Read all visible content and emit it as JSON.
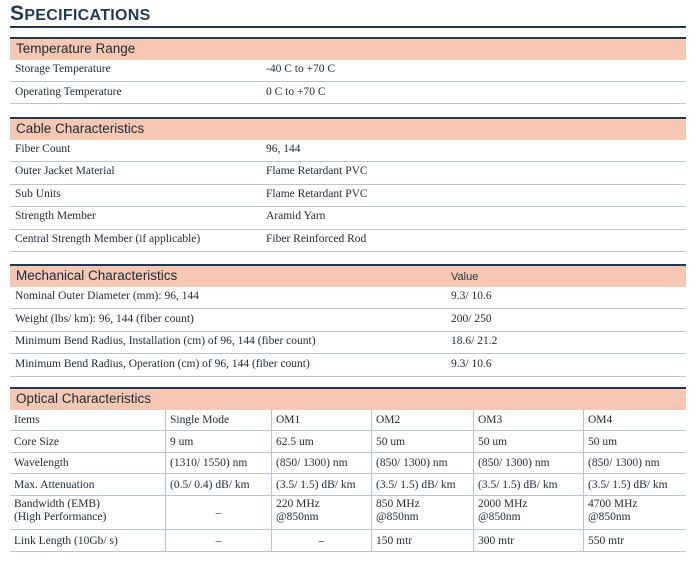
{
  "title": {
    "cap": "S",
    "rest": "PECIFICATIONS"
  },
  "temperature": {
    "header": "Temperature Range",
    "rows": [
      {
        "label": "Storage Temperature",
        "value": "-40 C to +70 C"
      },
      {
        "label": "Operating Temperature",
        "value": "0 C to +70 C"
      }
    ]
  },
  "cable": {
    "header": "Cable Characteristics",
    "rows": [
      {
        "label": "Fiber Count",
        "value": "96, 144"
      },
      {
        "label": "Outer Jacket Material",
        "value": "Flame Retardant PVC"
      },
      {
        "label": "Sub Units",
        "value": "Flame Retardant PVC"
      },
      {
        "label": "Strength Member",
        "value": "Aramid Yarn"
      },
      {
        "label": "Central Strength Member (if applicable)",
        "value": "Fiber Reinforced Rod"
      }
    ]
  },
  "mechanical": {
    "header": "Mechanical Characteristics",
    "value_header": "Value",
    "rows": [
      {
        "label": "Nominal Outer Diameter (mm): 96, 144",
        "value": "9.3/ 10.6"
      },
      {
        "label": "Weight (lbs/ km): 96, 144 (fiber count)",
        "value": "200/ 250"
      },
      {
        "label": "Minimum Bend Radius, Installation (cm) of 96, 144 (fiber count)",
        "value": "18.6/ 21.2"
      },
      {
        "label": "Minimum Bend Radius, Operation (cm) of 96, 144 (fiber count)",
        "value": "9.3/ 10.6"
      }
    ]
  },
  "optical": {
    "header": "Optical Characteristics",
    "columns": [
      "Items",
      "Single Mode",
      "OM1",
      "OM2",
      "OM3",
      "OM4"
    ],
    "rows": [
      [
        "Core Size",
        "9 um",
        "62.5 um",
        "50 um",
        "50 um",
        "50 um"
      ],
      [
        "Wavelength",
        "(1310/ 1550) nm",
        "(850/ 1300) nm",
        "(850/ 1300) nm",
        "(850/ 1300) nm",
        "(850/ 1300) nm"
      ],
      [
        "Max. Attenuation",
        "(0.5/ 0.4) dB/ km",
        "(3.5/ 1.5) dB/ km",
        "(3.5/ 1.5) dB/ km",
        "(3.5/ 1.5) dB/ km",
        "(3.5/ 1.5) dB/ km"
      ],
      [
        "Bandwidth (EMB)\n(High Performance)",
        "–",
        "220 MHz\n@850nm",
        "850 MHz\n@850nm",
        "2000 MHz\n@850nm",
        "4700 MHz\n@850nm"
      ],
      [
        "Link Length (10Gb/ s)",
        "–",
        "–",
        "150 mtr",
        "300 mtr",
        "550 mtr"
      ]
    ]
  }
}
